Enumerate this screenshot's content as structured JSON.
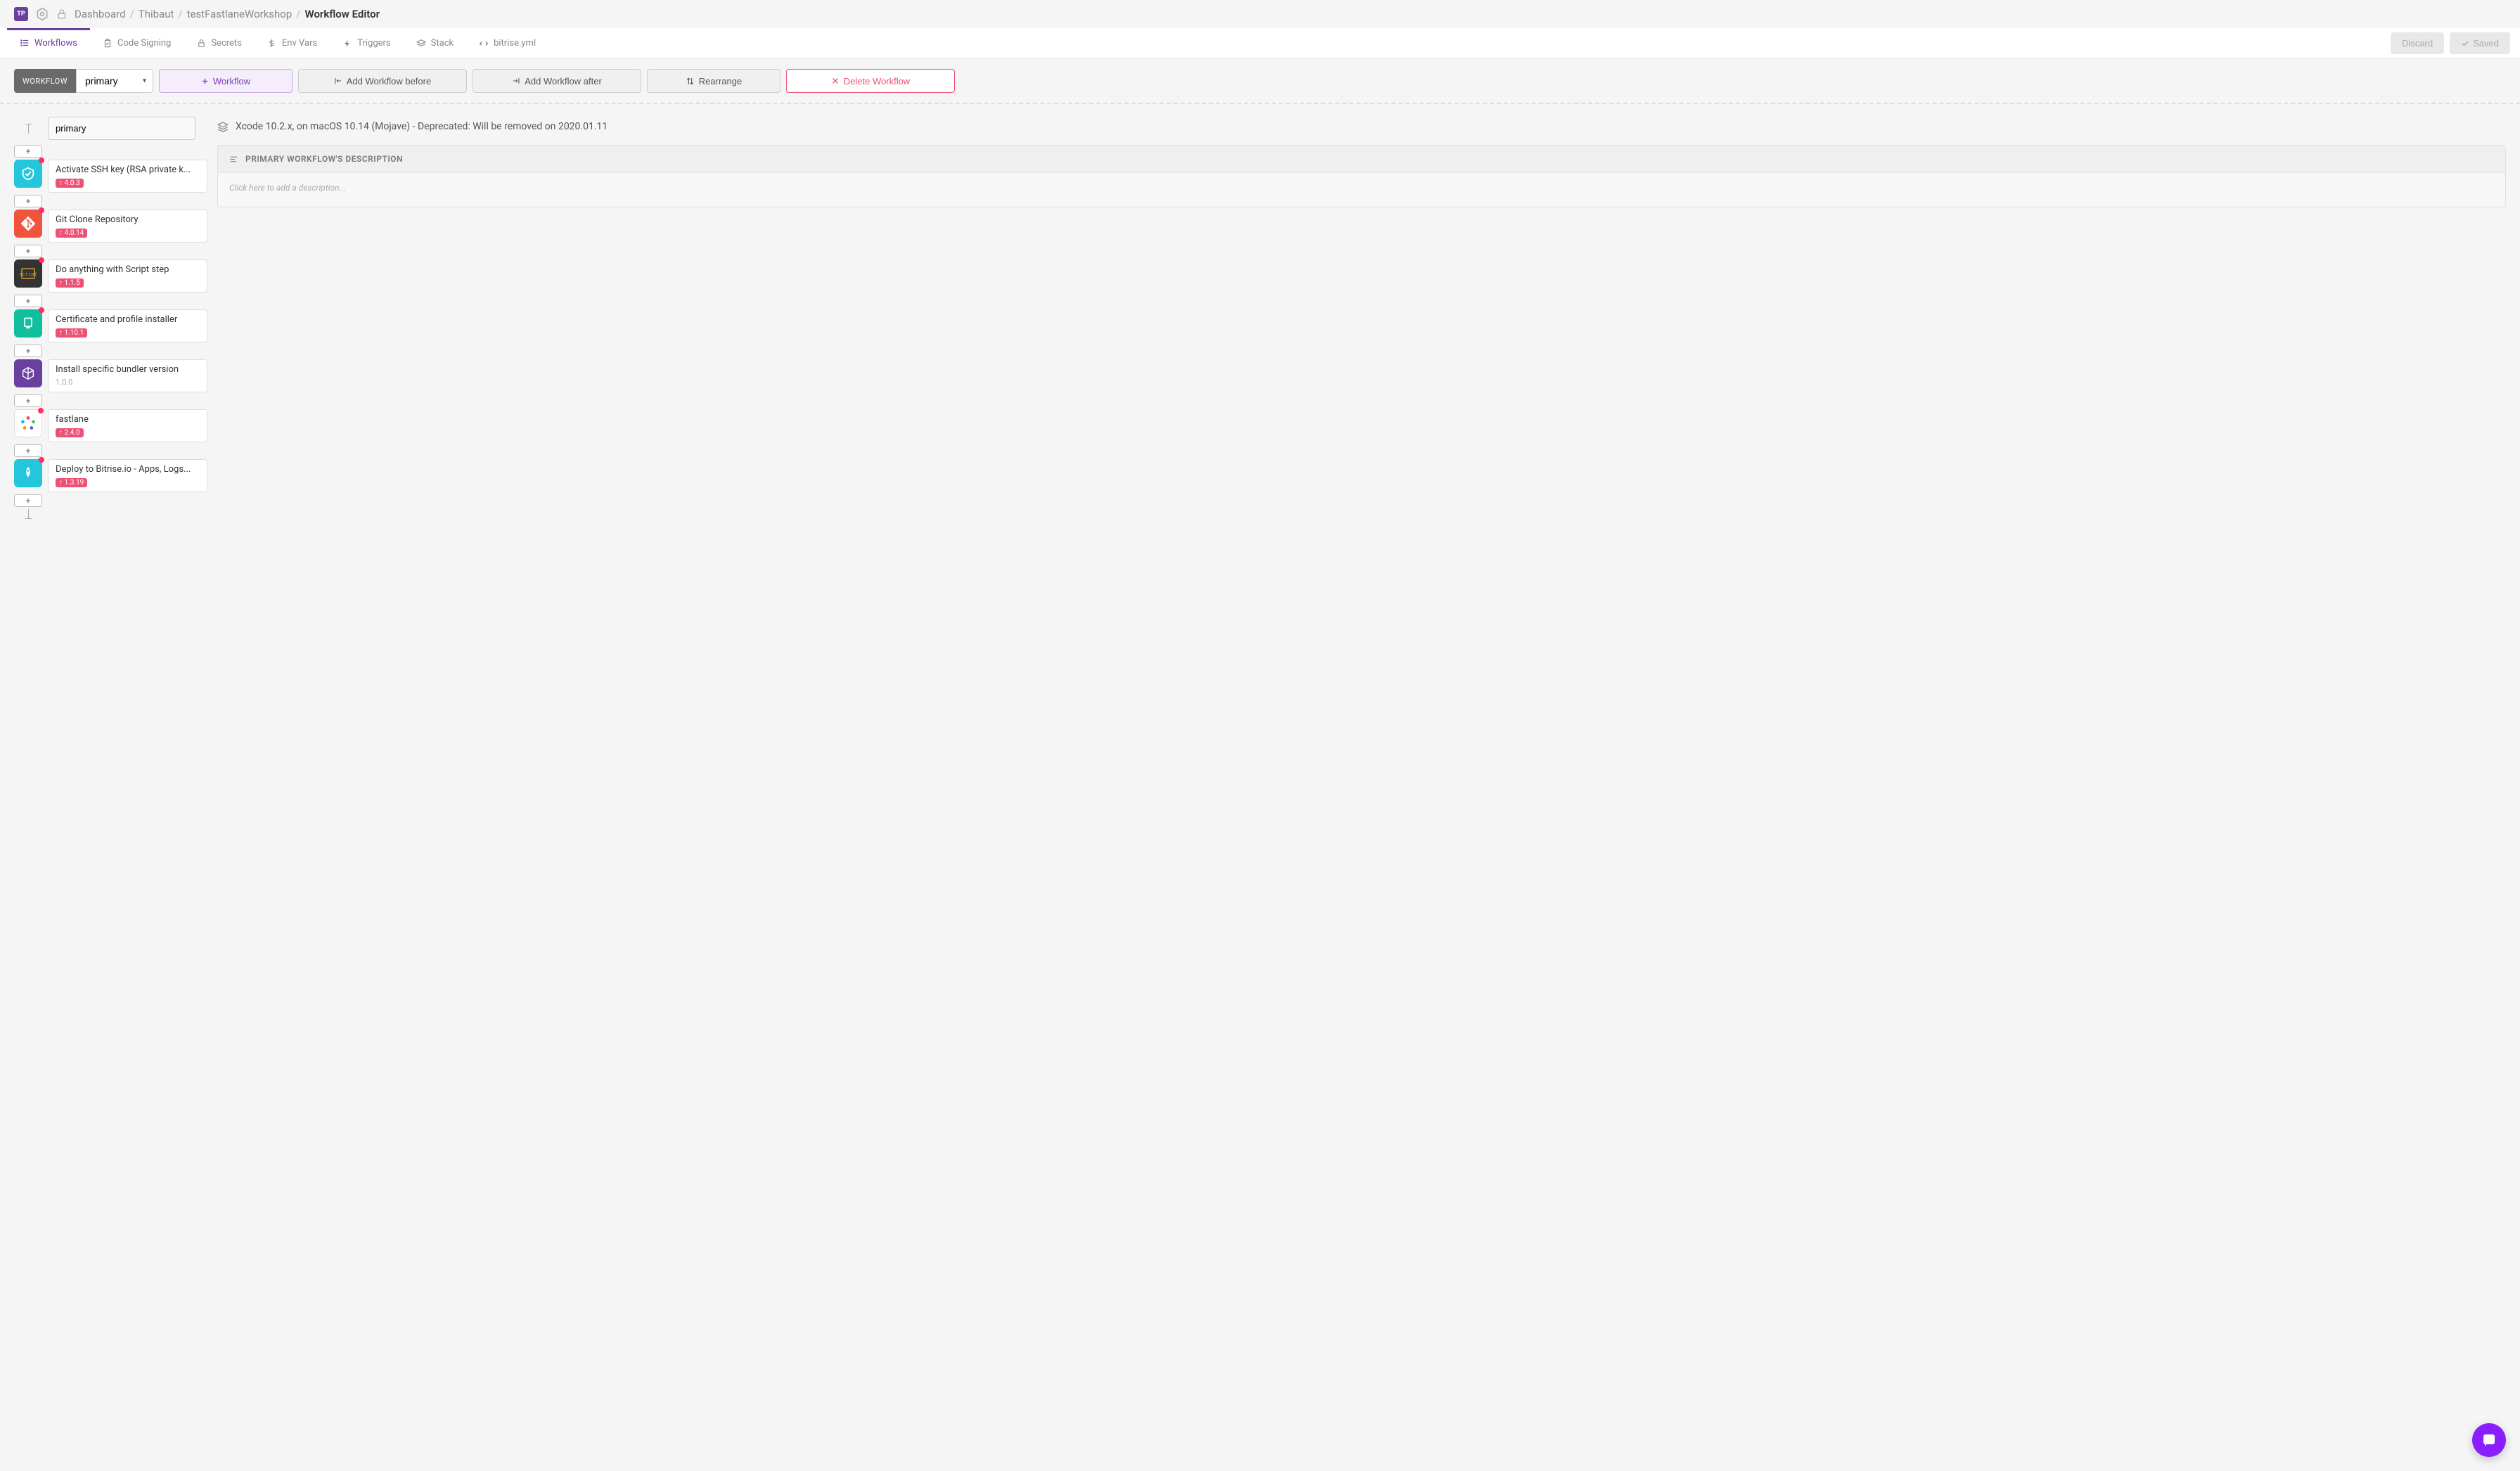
{
  "avatar": "TP",
  "breadcrumb": {
    "dashboard": "Dashboard",
    "user": "Thibaut",
    "project": "testFastlaneWorkshop",
    "current": "Workflow Editor"
  },
  "tabs": {
    "workflows": "Workflows",
    "code_signing": "Code Signing",
    "secrets": "Secrets",
    "env_vars": "Env Vars",
    "triggers": "Triggers",
    "stack": "Stack",
    "bitrise_yml": "bitrise.yml"
  },
  "buttons": {
    "discard": "Discard",
    "saved": "Saved"
  },
  "toolbar": {
    "workflow_label": "WORKFLOW",
    "selected_workflow": "primary",
    "add_workflow": "Workflow",
    "add_before": "Add Workflow before",
    "add_after": "Add Workflow after",
    "rearrange": "Rearrange",
    "delete": "Delete Workflow"
  },
  "workflow_name_input": "primary",
  "stack_info": "Xcode 10.2.x, on macOS 10.14 (Mojave) - Deprecated: Will be removed on 2020.01.11",
  "description": {
    "title": "PRIMARY WORKFLOW'S DESCRIPTION",
    "placeholder": "Click here to add a description..."
  },
  "steps": [
    {
      "title": "Activate SSH key (RSA private k...",
      "version": "4.0.3",
      "update": true,
      "icon": "ssh"
    },
    {
      "title": "Git Clone Repository",
      "version": "4.0.14",
      "update": true,
      "icon": "git"
    },
    {
      "title": "Do anything with Script step",
      "version": "1.1.5",
      "update": true,
      "icon": "script"
    },
    {
      "title": "Certificate and profile installer",
      "version": "1.10.1",
      "update": true,
      "icon": "cert"
    },
    {
      "title": "Install specific bundler version",
      "version": "1.0.0",
      "update": false,
      "icon": "bundler"
    },
    {
      "title": "fastlane",
      "version": "2.4.0",
      "update": true,
      "icon": "fastlane"
    },
    {
      "title": "Deploy to Bitrise.io - Apps, Logs...",
      "version": "1.3.19",
      "update": true,
      "icon": "deploy"
    }
  ],
  "add_symbol": "+"
}
